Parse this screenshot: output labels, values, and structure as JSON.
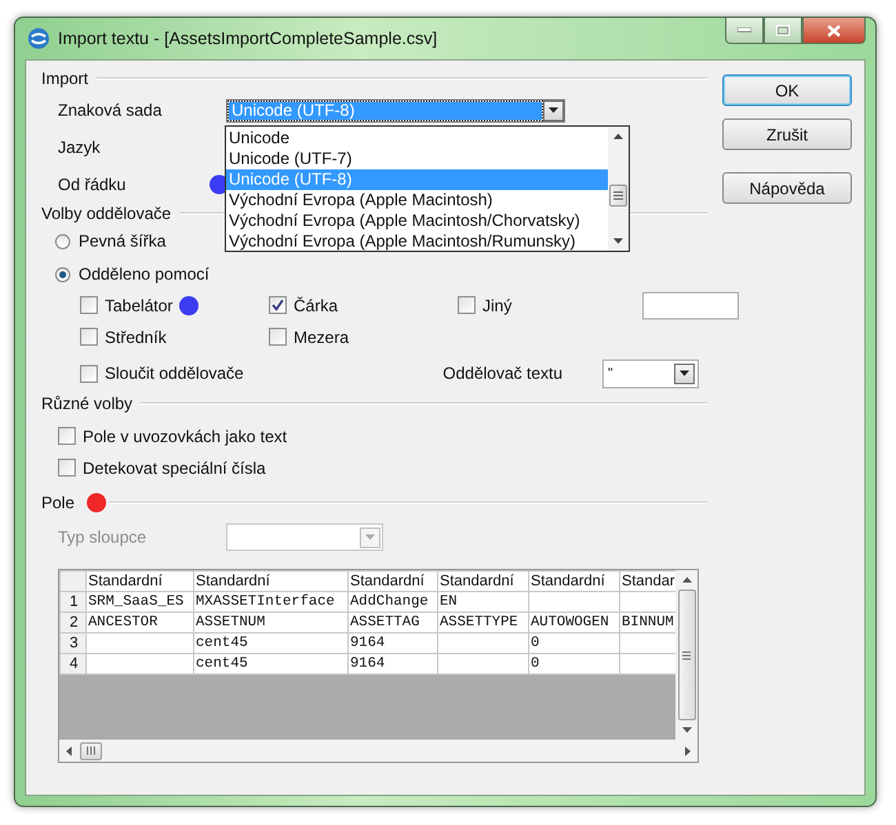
{
  "window": {
    "title": "Import textu - [AssetsImportCompleteSample.csv]"
  },
  "import": {
    "title": "Import",
    "fields": [
      {
        "label": "Znaková sada",
        "kind": "combo",
        "value": "Unicode (UTF-8)",
        "expanded": true,
        "options": [
          {
            "label": "Unicode",
            "selected": false
          },
          {
            "label": "Unicode (UTF-7)",
            "selected": false
          },
          {
            "label": "Unicode (UTF-8)",
            "selected": true
          },
          {
            "label": "Východní Evropa (Apple Macintosh)",
            "selected": false
          },
          {
            "label": "Východní Evropa (Apple Macintosh/Chorvatsky)",
            "selected": false
          },
          {
            "label": "Východní Evropa (Apple Macintosh/Rumunsky)",
            "selected": false
          }
        ]
      },
      {
        "label": "Jazyk",
        "kind": "covered"
      },
      {
        "label": "Od řádku",
        "kind": "covered",
        "marker": {
          "color": "#3c3cf2"
        }
      }
    ]
  },
  "separator_options": {
    "title": "Volby oddělovače",
    "modes": [
      {
        "label": "Pevná šířka",
        "selected": false
      },
      {
        "label": "Odděleno pomocí",
        "selected": true
      }
    ],
    "separators": [
      {
        "label": "Tabelátor",
        "kind": "check",
        "checked": false,
        "marker": {
          "color": "#3c3cf2"
        }
      },
      {
        "label": "Čárka",
        "kind": "check",
        "checked": true
      },
      {
        "label": "Jiný",
        "kind": "other",
        "checked": false
      },
      {
        "label": "Středník",
        "kind": "check",
        "checked": false
      },
      {
        "label": "Mezera",
        "kind": "check",
        "checked": false
      }
    ],
    "merge": {
      "label": "Sloučit oddělovače",
      "checked": false
    },
    "text_delimiter": {
      "label": "Oddělovač textu",
      "value": "\""
    }
  },
  "other_options": {
    "title": "Různé volby",
    "options": [
      {
        "label": "Pole v uvozovkách jako text",
        "checked": false
      },
      {
        "label": "Detekovat speciální čísla",
        "checked": false
      }
    ]
  },
  "fields": {
    "title": "Pole",
    "marker": {
      "color": "#f02828"
    },
    "column_type": {
      "label": "Typ sloupce",
      "disabled": true
    },
    "table": {
      "columns": [
        "Standardní",
        "Standardní",
        "Standardní",
        "Standardní",
        "Standardní",
        "Standar"
      ],
      "rows": [
        {
          "number": "1",
          "cells": [
            "SRM_SaaS_ES",
            "MXASSETInterface",
            "AddChange",
            "EN",
            null,
            null
          ]
        },
        {
          "number": "2",
          "cells": [
            "ANCESTOR",
            "ASSETNUM",
            "ASSETTAG",
            "ASSETTYPE",
            "AUTOWOGEN",
            "BINNUM"
          ]
        },
        {
          "number": "3",
          "cells": [
            null,
            "cent45",
            "9164",
            null,
            "0",
            null
          ]
        },
        {
          "number": "4",
          "cells": [
            null,
            "cent45",
            "9164",
            null,
            "0",
            null
          ]
        }
      ]
    }
  },
  "buttons": [
    {
      "label": "OK",
      "default": true
    },
    {
      "label": "Zrušit",
      "default": false
    },
    {
      "label": "Nápověda",
      "default": false
    }
  ]
}
